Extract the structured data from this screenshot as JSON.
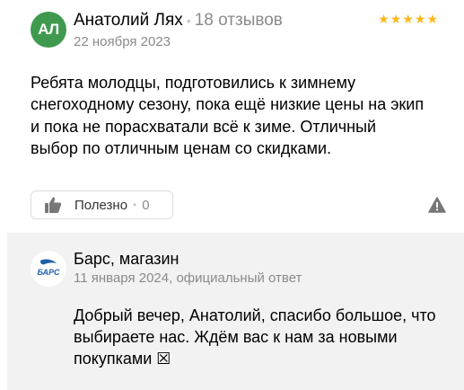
{
  "review": {
    "avatar_initials": "АЛ",
    "avatar_color": "#3f9a4f",
    "author": "Анатолий Лях",
    "reviews_count": "18 отзывов",
    "rating": 5,
    "stars_text": "★★★★★",
    "date": "22 ноября 2023",
    "text": "Ребята молодцы, подготовились к зимнему снегоходному сезону, пока ещё низкие цены на экип и пока не порасхватали всё к зиме. Отличный выбор по отличным ценам со скидками.",
    "useful_label": "Полезно",
    "useful_count": "0"
  },
  "reply": {
    "shop_name": "Барс, магазин",
    "logo_text": "БАРС",
    "date": "11 января 2024",
    "type": "официальный ответ",
    "text": "Добрый вечер, Анатолий, спасибо большое, что выбираете нас. Ждём вас к нам за новыми покупками ☒"
  }
}
